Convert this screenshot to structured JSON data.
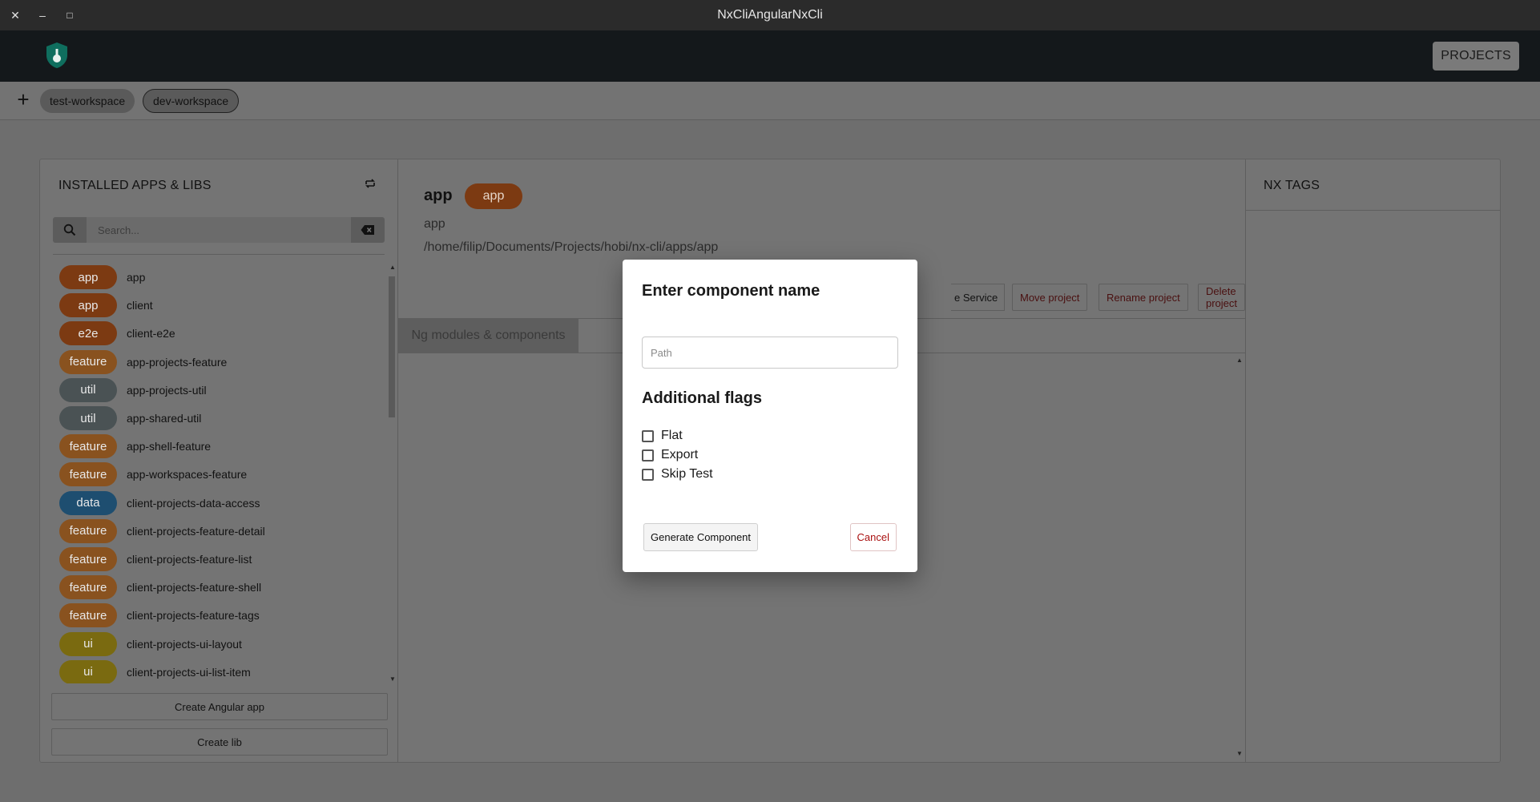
{
  "window": {
    "title": "NxCliAngularNxCli",
    "close_glyph": "✕",
    "min_glyph": "–",
    "max_glyph": "□"
  },
  "header": {
    "projects_label": "PROJECTS",
    "logo_icon": "nx-shield-logo"
  },
  "workspaces": {
    "add_glyph": "+",
    "items": [
      {
        "label": "test-workspace"
      },
      {
        "label": "dev-workspace"
      }
    ]
  },
  "sidebar": {
    "title": "INSTALLED APPS & LIBS",
    "search_placeholder": "Search...",
    "items": [
      {
        "badge": "app",
        "badge_color": "#7c3a12",
        "label": "app"
      },
      {
        "badge": "app",
        "badge_color": "#7c3a12",
        "label": "client"
      },
      {
        "badge": "e2e",
        "badge_color": "#7c3a12",
        "label": "client-e2e"
      },
      {
        "badge": "feature",
        "badge_color": "#89521f",
        "label": "app-projects-feature"
      },
      {
        "badge": "util",
        "badge_color": "#4a5254",
        "label": "app-projects-util"
      },
      {
        "badge": "util",
        "badge_color": "#4a5254",
        "label": "app-shared-util"
      },
      {
        "badge": "feature",
        "badge_color": "#89521f",
        "label": "app-shell-feature"
      },
      {
        "badge": "feature",
        "badge_color": "#89521f",
        "label": "app-workspaces-feature"
      },
      {
        "badge": "data",
        "badge_color": "#1e4e70",
        "label": "client-projects-data-access"
      },
      {
        "badge": "feature",
        "badge_color": "#89521f",
        "label": "client-projects-feature-detail"
      },
      {
        "badge": "feature",
        "badge_color": "#89521f",
        "label": "client-projects-feature-list"
      },
      {
        "badge": "feature",
        "badge_color": "#89521f",
        "label": "client-projects-feature-shell"
      },
      {
        "badge": "feature",
        "badge_color": "#89521f",
        "label": "client-projects-feature-tags"
      },
      {
        "badge": "ui",
        "badge_color": "#7a6a10",
        "label": "client-projects-ui-layout"
      },
      {
        "badge": "ui",
        "badge_color": "#7a6a10",
        "label": "client-projects-ui-list-item"
      }
    ],
    "create_app_label": "Create Angular app",
    "create_lib_label": "Create lib"
  },
  "project": {
    "name": "app",
    "badge": "app",
    "subtitle": "app",
    "path": "/home/filip/Documents/Projects/hobi/nx-cli/apps/app",
    "partial_action_label": "e Service",
    "actions": [
      {
        "label": "Move project"
      },
      {
        "label": "Rename project"
      },
      {
        "label": "Delete project"
      }
    ],
    "active_tab": "Ng modules & components"
  },
  "tags_panel": {
    "title": "NX TAGS"
  },
  "dialog": {
    "title": "Enter component name",
    "path_placeholder": "Path",
    "flags_title": "Additional flags",
    "flags": [
      {
        "label": "Flat",
        "checked": false
      },
      {
        "label": "Export",
        "checked": false
      },
      {
        "label": "Skip Test",
        "checked": false
      }
    ],
    "generate_label": "Generate Component",
    "cancel_label": "Cancel"
  }
}
